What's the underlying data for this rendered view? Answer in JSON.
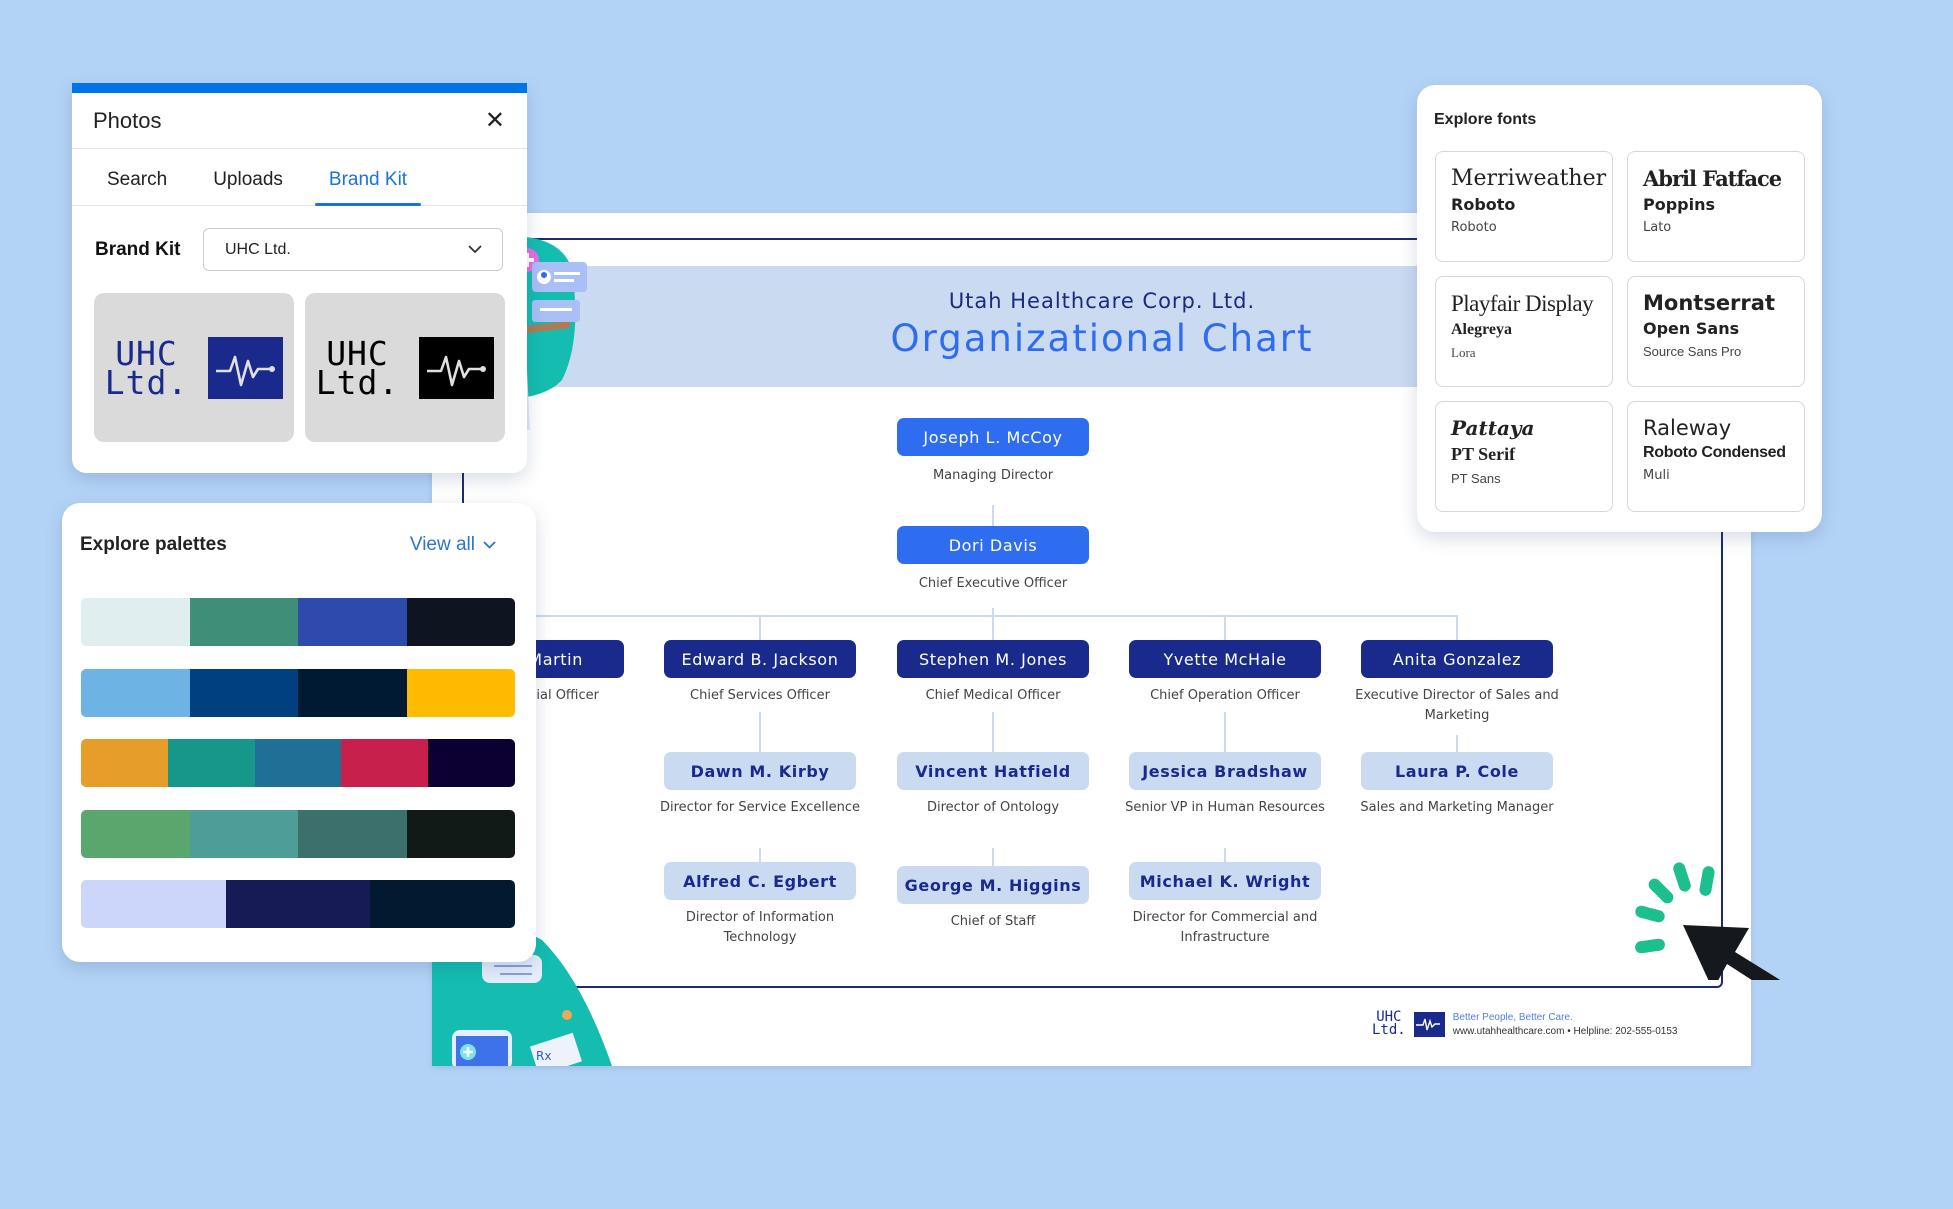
{
  "photos_panel": {
    "title": "Photos",
    "close_icon": "close-icon",
    "tabs": [
      {
        "label": "Search",
        "active": false
      },
      {
        "label": "Uploads",
        "active": false
      },
      {
        "label": "Brand Kit",
        "active": true
      }
    ],
    "brand_kit_label": "Brand Kit",
    "brand_kit_selected": "UHC Ltd.",
    "logos": [
      {
        "line1": "UHC",
        "line2": "Ltd.",
        "text_color": "#1a2a8c",
        "box_color": "#1a2a8c",
        "icon": "heartbeat-icon"
      },
      {
        "line1": "UHC",
        "line2": "Ltd.",
        "text_color": "#000000",
        "box_color": "#000000",
        "icon": "heartbeat-icon"
      }
    ]
  },
  "palettes_panel": {
    "title": "Explore palettes",
    "view_all_label": "View all",
    "palettes": [
      [
        "#e0eef0",
        "#3f8f78",
        "#2d4aad",
        "#0e1520"
      ],
      [
        "#6db3e3",
        "#003f80",
        "#001a33",
        "#ffbb00"
      ],
      [
        "#e69d2a",
        "#17968a",
        "#1f6f96",
        "#c8204c",
        "#0b0030"
      ],
      [
        "#5ba66c",
        "#4f9d98",
        "#3b706d",
        "#121a18"
      ],
      [
        "#ccd6fa",
        "#161a55",
        "#011a30"
      ]
    ]
  },
  "fonts_panel": {
    "title": "Explore fonts",
    "pairings": [
      {
        "heading": "Merriweather",
        "body": "Roboto",
        "small": "Roboto"
      },
      {
        "heading": "Abril Fatface",
        "body": "Poppins",
        "small": "Lato"
      },
      {
        "heading": "Playfair Display",
        "body": "Alegreya",
        "small": "Lora"
      },
      {
        "heading": "Montserrat",
        "body": "Open Sans",
        "small": "Source Sans Pro"
      },
      {
        "heading": "Pattaya",
        "body": "PT Serif",
        "small": "PT Sans"
      },
      {
        "heading": "Raleway",
        "body": "Roboto Condensed",
        "small": "Muli"
      }
    ]
  },
  "document": {
    "company": "Utah Healthcare Corp. Ltd.",
    "title": "Organizational Chart",
    "top": [
      {
        "name": "Joseph L. McCoy",
        "role": "Managing Director"
      },
      {
        "name": "Dori Davis",
        "role": "Chief Executive Officer"
      }
    ],
    "executives": [
      {
        "name": "Claire Martin",
        "role": "Chief Financial Officer",
        "reports": []
      },
      {
        "name": "Edward B. Jackson",
        "role": "Chief Services Officer",
        "reports": [
          {
            "name": "Dawn M. Kirby",
            "role": "Director for Service Excellence"
          },
          {
            "name": "Alfred C. Egbert",
            "role": "Director of Information Technology"
          }
        ]
      },
      {
        "name": "Stephen M. Jones",
        "role": "Chief Medical Officer",
        "reports": [
          {
            "name": "Vincent Hatfield",
            "role": "Director of Ontology"
          },
          {
            "name": "George M. Higgins",
            "role": "Chief of Staff"
          }
        ]
      },
      {
        "name": "Yvette McHale",
        "role": "Chief Operation Officer",
        "reports": [
          {
            "name": "Jessica Bradshaw",
            "role": "Senior VP in Human Resources"
          },
          {
            "name": "Michael K. Wright",
            "role": "Director for Commercial and Infrastructure"
          }
        ]
      },
      {
        "name": "Anita Gonzalez",
        "role": "Executive Director of Sales and Marketing",
        "reports": [
          {
            "name": "Laura P. Cole",
            "role": "Sales and Marketing Manager"
          }
        ]
      }
    ],
    "footer": {
      "logo_line1": "UHC",
      "logo_line2": "Ltd.",
      "tagline": "Better People, Better Care.",
      "contact": "www.utahhealthcare.com • Helpline: 202-555-0153"
    }
  },
  "colors": {
    "background": "#b3d3f6",
    "accent_blue": "#2f6df0",
    "navy": "#1a2a8c",
    "light_blue": "#cadaf0",
    "tab_active": "#1a73d9",
    "click_burst": "#1dbf8e"
  }
}
